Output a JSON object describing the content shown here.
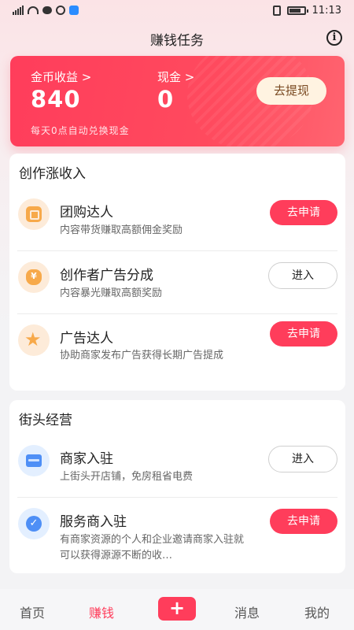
{
  "status_bar": {
    "time": "11:13",
    "network_label": "4G"
  },
  "header": {
    "title": "赚钱任务"
  },
  "earnings": {
    "coin_label": "金币收益 >",
    "coin_value": "840",
    "cash_label": "现金 >",
    "cash_value": "0",
    "note": "每天0点自动兑换现金",
    "withdraw_label": "去提现"
  },
  "creator_section": {
    "title": "创作涨收入",
    "items": [
      {
        "title": "团购达人",
        "desc": "内容带货赚取高额佣金奖励",
        "action": "去申请"
      },
      {
        "title": "创作者广告分成",
        "desc": "内容暴光赚取高额奖励",
        "action": "进入"
      },
      {
        "title": "广告达人",
        "desc": "协助商家发布广告获得长期广告提成",
        "action": "去申请"
      }
    ]
  },
  "street_section": {
    "title": "街头经营",
    "items": [
      {
        "title": "商家入驻",
        "desc": "上街头开店铺，免房租省电费",
        "action": "进入"
      },
      {
        "title": "服务商入驻",
        "desc": "有商家资源的个人和企业邀请商家入驻就可以获得源源不断的收…",
        "action": "去申请"
      }
    ]
  },
  "bottom_nav": {
    "home": "首页",
    "earn": "赚钱",
    "plus": "+",
    "messages": "消息",
    "mine": "我的"
  },
  "colors": {
    "accent": "#ff3d5b",
    "icon_orange": "#f7a94a",
    "icon_blue": "#4e8ff6"
  },
  "icons": [
    "signal-icon",
    "wifi-icon",
    "chat-icon",
    "q-icon",
    "app-icon",
    "vibrate-icon",
    "battery-icon",
    "info-icon",
    "group-buy-icon",
    "money-bag-icon",
    "star-icon",
    "shop-icon",
    "badge-check-icon"
  ]
}
